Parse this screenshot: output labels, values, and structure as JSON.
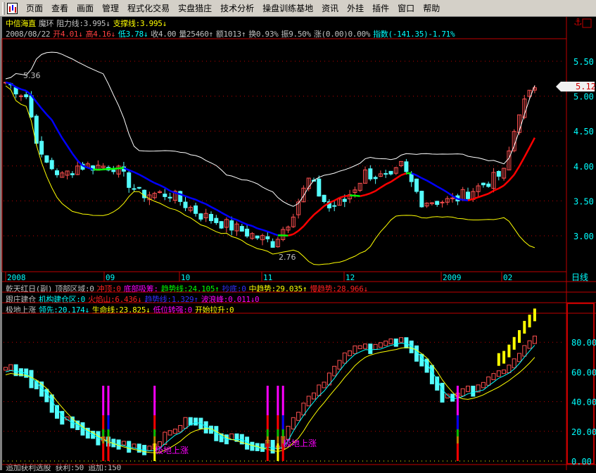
{
  "menu": [
    "页面",
    "查看",
    "画面",
    "管理",
    "程式化交易",
    "实盘猎庄",
    "技术分析",
    "操盘训练基地",
    "资讯",
    "外挂",
    "插件",
    "窗口",
    "帮助"
  ],
  "header": {
    "stock": "中信海直",
    "indicator": "魔环",
    "resist": "阻力线:3.995↓",
    "support": "支撑线:3.995↓",
    "date": "2008/08/22",
    "open": "开4.01↓",
    "high": "高4.16↓",
    "low": "低3.78↓",
    "close": "收4.00",
    "volume": "量25460↑",
    "amount": "额1013↑",
    "turnover": "换0.93%",
    "amplitude": "振9.50%",
    "change": "涨(0.00)0.00%",
    "index": "指数(-141.35)-1.71%"
  },
  "main": {
    "current_price": "5.12",
    "high_mark": "5.36",
    "low_mark": "2.76",
    "y_ticks": [
      "5.50",
      "5.00",
      "4.50",
      "4.00",
      "3.50",
      "3.00"
    ],
    "time_labels": [
      "2008",
      "09",
      "10",
      "11",
      "12",
      "2009",
      "02"
    ],
    "period": "日线"
  },
  "ind1": {
    "name": "乾天红日(副)",
    "top": "顶部区域:0",
    "rush": "冲顶:0",
    "bottom": "底部吸筹:",
    "trend": "趋势线:24.105↑",
    "dip": "抄底:0",
    "mid": "中趋势:29.035↑",
    "slow": "慢趋势:28.966↓"
  },
  "ind2": {
    "name": "跟庄建仓",
    "inst": "机构建仓区:0",
    "fire": "火焰山:6.436↓",
    "trend": "趋势线:1.329↑",
    "wave": "波浪峰:0.011↓0"
  },
  "ind3": {
    "name": "极地上涨",
    "lead": "领先:20.174↓",
    "life": "生命线:23.825↓",
    "low": "低位转强:0",
    "start": "开始拉升:0"
  },
  "lower": {
    "y_ticks": [
      "80.00",
      "60.00",
      "40.00",
      "20.00",
      "0.00"
    ],
    "signal_text": "极地上涨"
  },
  "footer": "追加获利选股 获利:50 追加:150",
  "chart_data": {
    "type": "candlestick",
    "bars": 104,
    "price_keypoints": [
      [
        0,
        5.2
      ],
      [
        4,
        5.0
      ],
      [
        7,
        4.1
      ],
      [
        11,
        3.85
      ],
      [
        14,
        4.0
      ],
      [
        21,
        4.0
      ],
      [
        26,
        3.6
      ],
      [
        32,
        3.6
      ],
      [
        38,
        3.3
      ],
      [
        45,
        3.1
      ],
      [
        52,
        2.9
      ],
      [
        55,
        3.2
      ],
      [
        59,
        3.8
      ],
      [
        63,
        3.4
      ],
      [
        66,
        3.5
      ],
      [
        70,
        3.9
      ],
      [
        75,
        3.8
      ],
      [
        77,
        4.0
      ],
      [
        81,
        3.5
      ],
      [
        87,
        3.5
      ],
      [
        92,
        3.7
      ],
      [
        97,
        3.9
      ],
      [
        100,
        4.8
      ],
      [
        103,
        5.12
      ]
    ],
    "osc_keypoints": [
      [
        0,
        65
      ],
      [
        4,
        60
      ],
      [
        11,
        30
      ],
      [
        19,
        15
      ],
      [
        28,
        10
      ],
      [
        34,
        25
      ],
      [
        36,
        30
      ],
      [
        41,
        20
      ],
      [
        50,
        12
      ],
      [
        53,
        12
      ],
      [
        58,
        40
      ],
      [
        62,
        55
      ],
      [
        67,
        75
      ],
      [
        72,
        80
      ],
      [
        77,
        82
      ],
      [
        81,
        70
      ],
      [
        85,
        45
      ],
      [
        89,
        47
      ],
      [
        95,
        57
      ],
      [
        99,
        68
      ],
      [
        103,
        85
      ]
    ],
    "signal_bars": [
      19,
      20,
      29,
      51,
      53,
      54,
      88
    ],
    "price_range": [
      2.75,
      5.75
    ],
    "osc_range": [
      0,
      100
    ]
  }
}
